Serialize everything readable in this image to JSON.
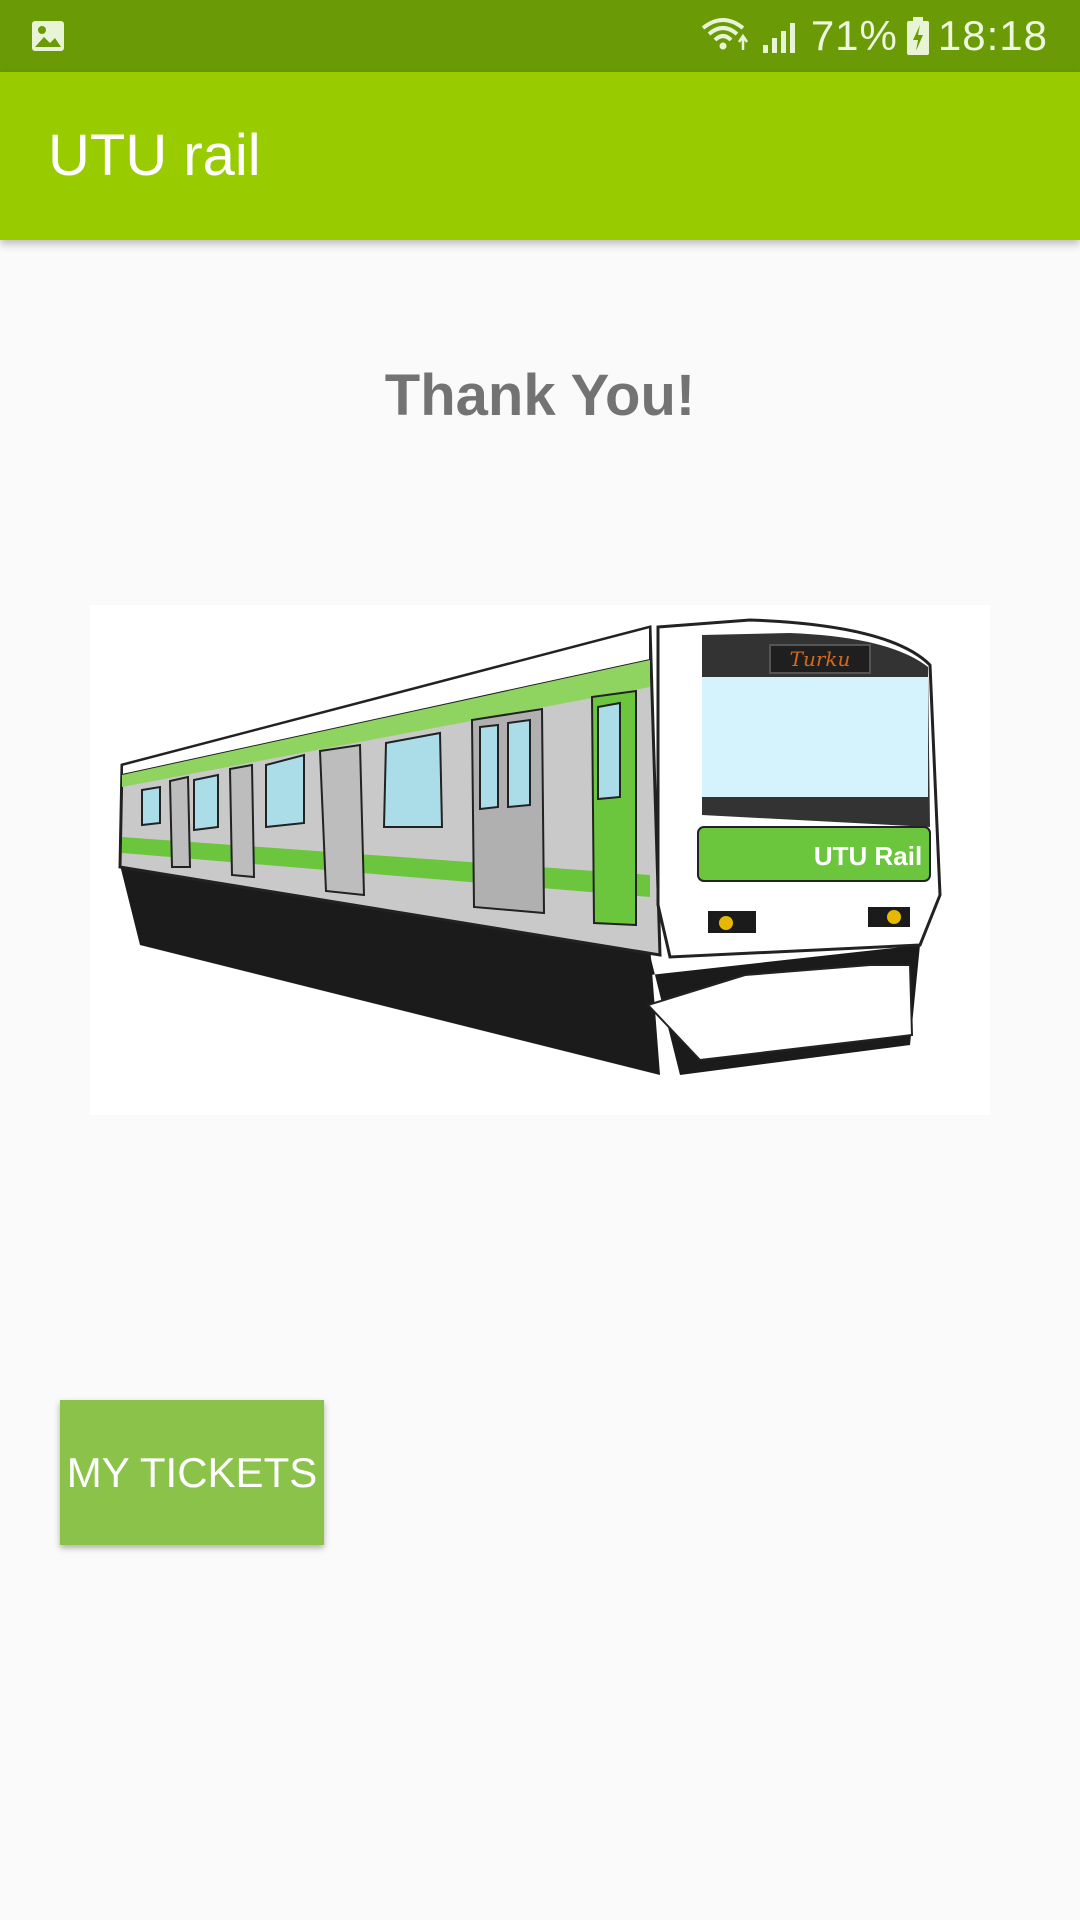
{
  "status_bar": {
    "battery_percent": "71%",
    "time": "18:18",
    "icons": [
      "gallery-icon",
      "wifi-icon",
      "signal-icon",
      "battery-icon"
    ]
  },
  "app_bar": {
    "title": "UTU rail"
  },
  "main": {
    "heading": "Thank You!",
    "train_image": {
      "destination_sign": "Turku",
      "logo_text": "UTU Rail"
    },
    "my_tickets_button": "MY TICKETS"
  },
  "colors": {
    "status_bar": "#6a9a06",
    "app_bar": "#99cc00",
    "button": "#8bc34a",
    "heading_text": "#737373",
    "background": "#fafafa"
  }
}
